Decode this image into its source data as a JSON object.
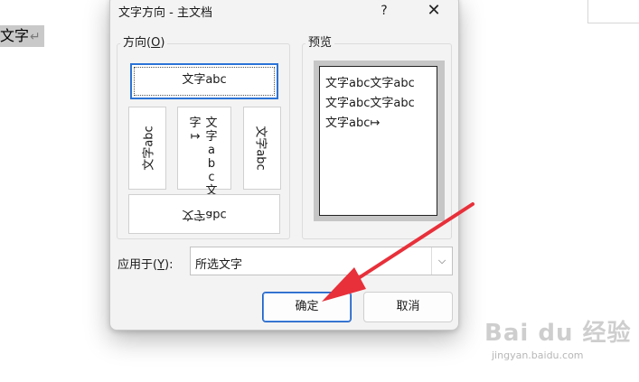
{
  "document": {
    "selected_text": "文字",
    "paragraph_mark": "↵"
  },
  "dialog": {
    "title": "文字方向 - 主文档",
    "help_glyph": "?",
    "close_glyph": "✕",
    "orientation": {
      "label": "方向(",
      "label_key": "O",
      "label_end": ")",
      "options": {
        "horizontal": "文字abc",
        "vertical_a": "文字abc",
        "vertical_b_col1": "文字abc文",
        "vertical_b_col2": "字↦",
        "vertical_c": "文字abc",
        "upside_down": "文字abc"
      }
    },
    "preview": {
      "label": "预览",
      "lines": [
        "文字abc文字abc",
        "文字abc文字abc",
        "文字abc↦"
      ]
    },
    "apply_to": {
      "label": "应用于(",
      "label_key": "Y",
      "label_end": "):",
      "value": "所选文字",
      "arrow_glyph": "⌵"
    },
    "buttons": {
      "ok": "确定",
      "cancel": "取消"
    }
  },
  "watermark": {
    "main": "Bai du 经验",
    "sub": "jingyan.baidu.com"
  },
  "colors": {
    "annotation_arrow": "#e8303a",
    "selection_border": "#2b73d6"
  }
}
